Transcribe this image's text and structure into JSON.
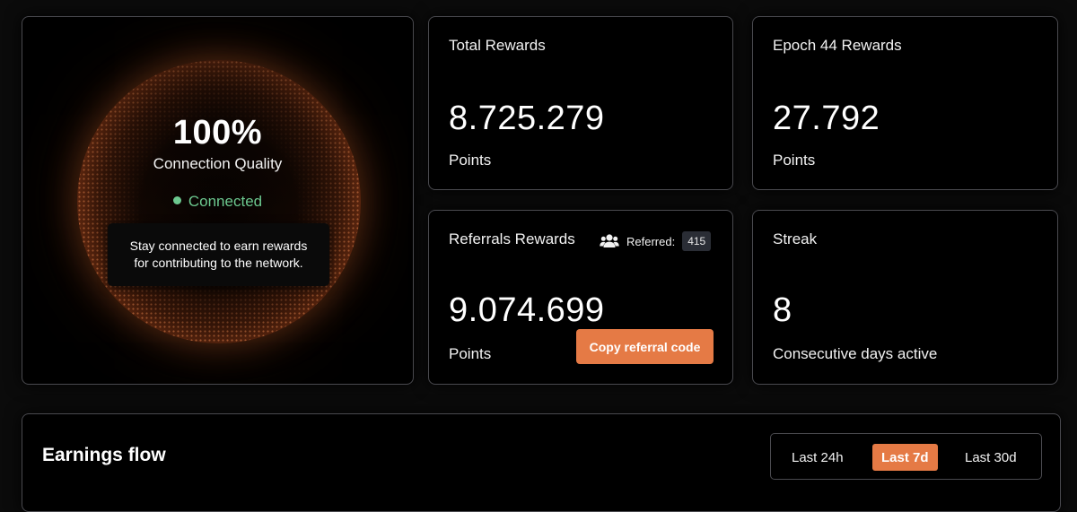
{
  "connection": {
    "quality_value": "100%",
    "quality_label": "Connection Quality",
    "status": "Connected",
    "tooltip_line1": "Stay connected to earn rewards",
    "tooltip_line2": "for contributing to the network."
  },
  "total_rewards": {
    "title": "Total Rewards",
    "value": "8.725.279",
    "unit": "Points"
  },
  "epoch_rewards": {
    "title": "Epoch 44 Rewards",
    "value": "27.792",
    "unit": "Points"
  },
  "referral_rewards": {
    "title": "Referrals Rewards",
    "referred_label": "Referred:",
    "referred_count": "415",
    "value": "9.074.699",
    "unit": "Points",
    "copy_button": "Copy referral code",
    "icon": "users-icon"
  },
  "streak": {
    "title": "Streak",
    "value": "8",
    "unit": "Consecutive days active"
  },
  "earnings": {
    "title": "Earnings flow",
    "ranges": [
      "Last 24h",
      "Last 7d",
      "Last 30d"
    ],
    "selected_range": "Last 7d"
  },
  "colors": {
    "accent": "#e57a45",
    "connected": "#6cc88f",
    "border": "#4a4a4f"
  }
}
